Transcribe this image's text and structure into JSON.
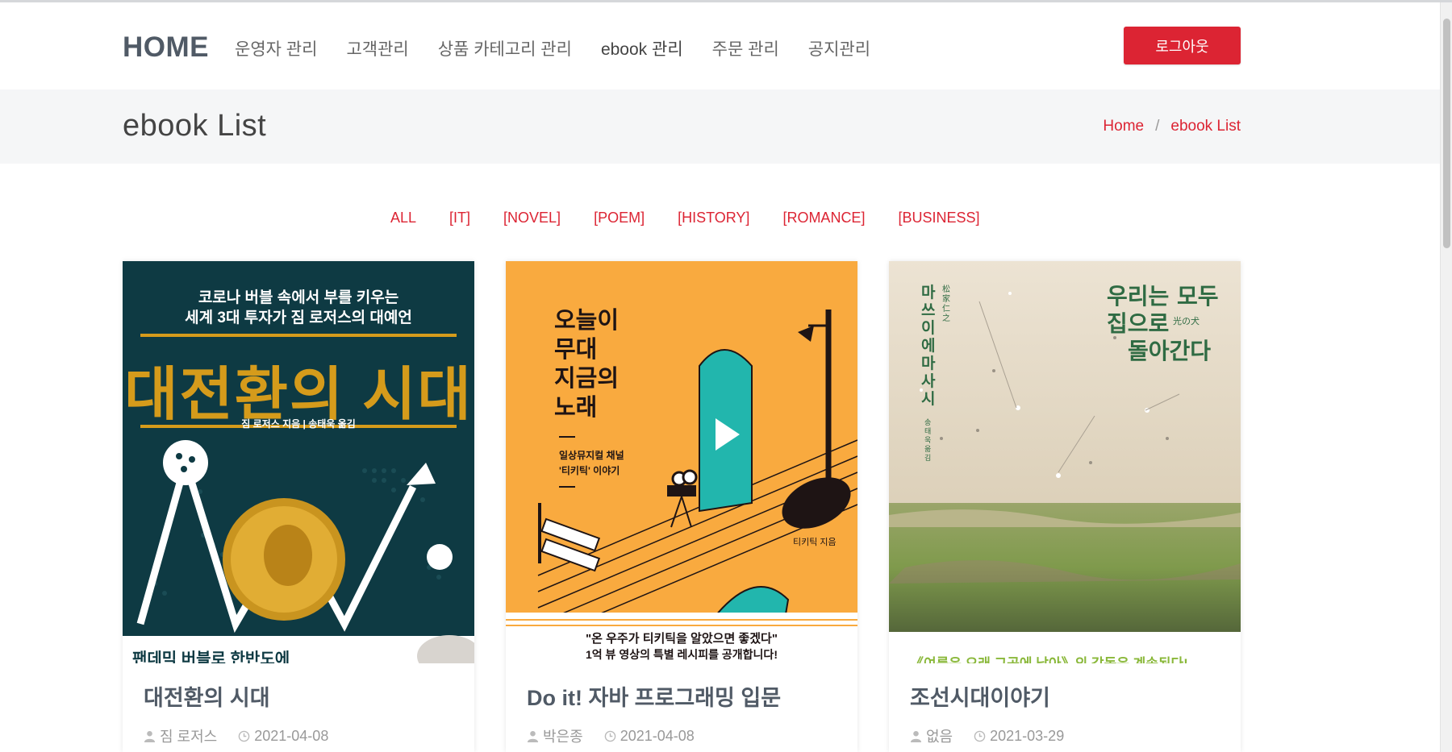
{
  "header": {
    "brand": "HOME",
    "nav": [
      "운영자 관리",
      "고객관리",
      "상품 카테고리 관리",
      "ebook 관리",
      "주문 관리",
      "공지관리"
    ],
    "logout_label": "로그아웃"
  },
  "page": {
    "title": "ebook List",
    "breadcrumb": {
      "home": "Home",
      "separator": "/",
      "current": "ebook List"
    }
  },
  "filters": [
    "ALL",
    "[IT]",
    "[NOVEL]",
    "[POEM]",
    "[HISTORY]",
    "[ROMANCE]",
    "[BUSINESS]"
  ],
  "books": [
    {
      "title": "대전환의 시대",
      "author": "짐 로저스",
      "date": "2021-04-08",
      "cover": {
        "top_line1": "코로나 버블 속에서 부를 키우는",
        "top_line2": "세계 3대 투자가 짐 로저스의 대예언",
        "big_title": "대전환의 시대",
        "credit": "짐 로저스 지음 | 송태욱 옮김",
        "bottom_text": "팬데믹 버블로 한반도에"
      }
    },
    {
      "title": "Do it! 자바 프로그래밍 입문",
      "author": "박은종",
      "date": "2021-04-08",
      "cover": {
        "big_title_1": "오늘이",
        "big_title_2": "무대",
        "big_title_3": "지금의",
        "big_title_4": "노래",
        "sub_1": "일상뮤지컬 채널",
        "sub_2": "'티키틱' 이야기",
        "credit": "티키틱 지음",
        "bottom_1": "\"온 우주가 티키틱을 알았으면 좋겠다\"",
        "bottom_2": "1억 뷰 영상의 특별 레시피를 공개합니다!"
      }
    },
    {
      "title": "조선시대이야기",
      "author": "없음",
      "date": "2021-03-29",
      "cover": {
        "title_1": "우리는 모두",
        "title_2": "집으로",
        "title_2_jp": "光の犬",
        "title_3": "돌아간다",
        "author_v": "마쓰이에 마사시",
        "author_jp": "松家仁之",
        "translator": "송태욱 옮김",
        "bottom": "《여름은 오래 그곳에 남아》의 감동은 계속된다!"
      }
    }
  ],
  "colors": {
    "accent": "#dc2433",
    "brand": "#505a66",
    "title_bar": "#f5f6f7"
  }
}
